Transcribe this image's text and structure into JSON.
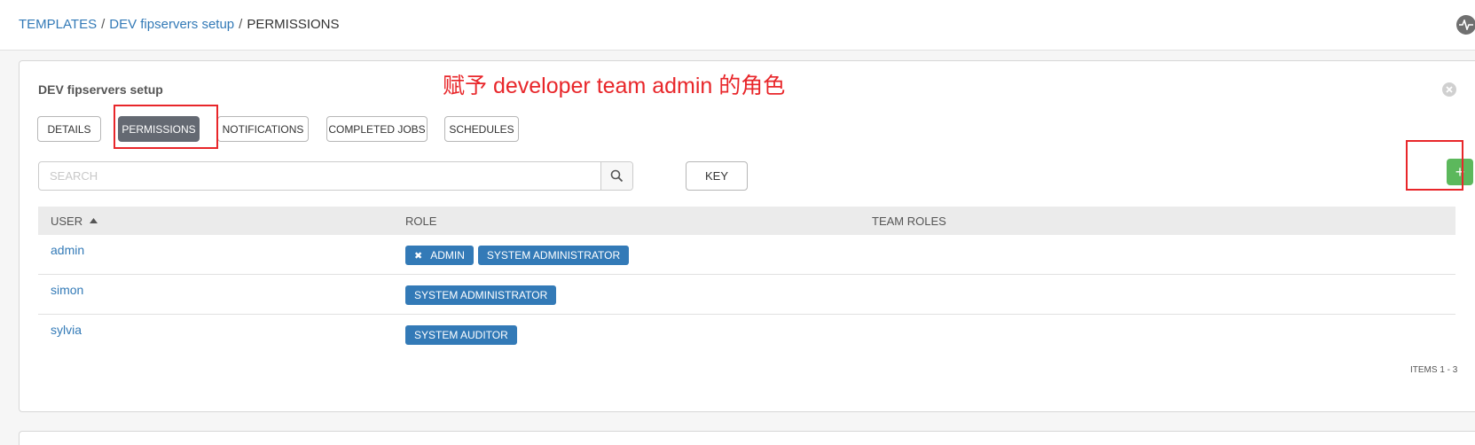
{
  "breadcrumb": {
    "items": [
      {
        "label": "TEMPLATES"
      },
      {
        "label": "DEV fipservers setup"
      },
      {
        "label": "PERMISSIONS"
      }
    ],
    "separator": "/"
  },
  "header": {
    "activity_icon": "activity-pulse-icon"
  },
  "panel": {
    "title": "DEV fipservers setup",
    "annotation": "赋予 developer team admin 的角色",
    "close_icon": "close-circle-icon"
  },
  "tabs": [
    {
      "label": "DETAILS",
      "active": false
    },
    {
      "label": "PERMISSIONS",
      "active": true
    },
    {
      "label": "NOTIFICATIONS",
      "active": false
    },
    {
      "label": "COMPLETED JOBS",
      "active": false
    },
    {
      "label": "SCHEDULES",
      "active": false
    }
  ],
  "search": {
    "placeholder": "SEARCH",
    "value": "",
    "icon": "search-icon"
  },
  "key_button": {
    "label": "KEY"
  },
  "add_button": {
    "label": "+"
  },
  "table": {
    "columns": [
      {
        "label": "USER",
        "sorted": "ascending"
      },
      {
        "label": "ROLE"
      },
      {
        "label": "TEAM ROLES"
      }
    ],
    "rows": [
      {
        "user": "admin",
        "roles": [
          {
            "label": "ADMIN",
            "removable": true
          },
          {
            "label": "SYSTEM ADMINISTRATOR",
            "removable": false
          }
        ]
      },
      {
        "user": "simon",
        "roles": [
          {
            "label": "SYSTEM ADMINISTRATOR",
            "removable": false
          }
        ]
      },
      {
        "user": "sylvia",
        "roles": [
          {
            "label": "SYSTEM AUDITOR",
            "removable": false
          }
        ]
      }
    ]
  },
  "items_count": "ITEMS  1 - 3",
  "colors": {
    "accent_link": "#337ab7",
    "active_tab": "#646972",
    "add_button": "#5cb85c",
    "annotation": "#e8262a"
  }
}
